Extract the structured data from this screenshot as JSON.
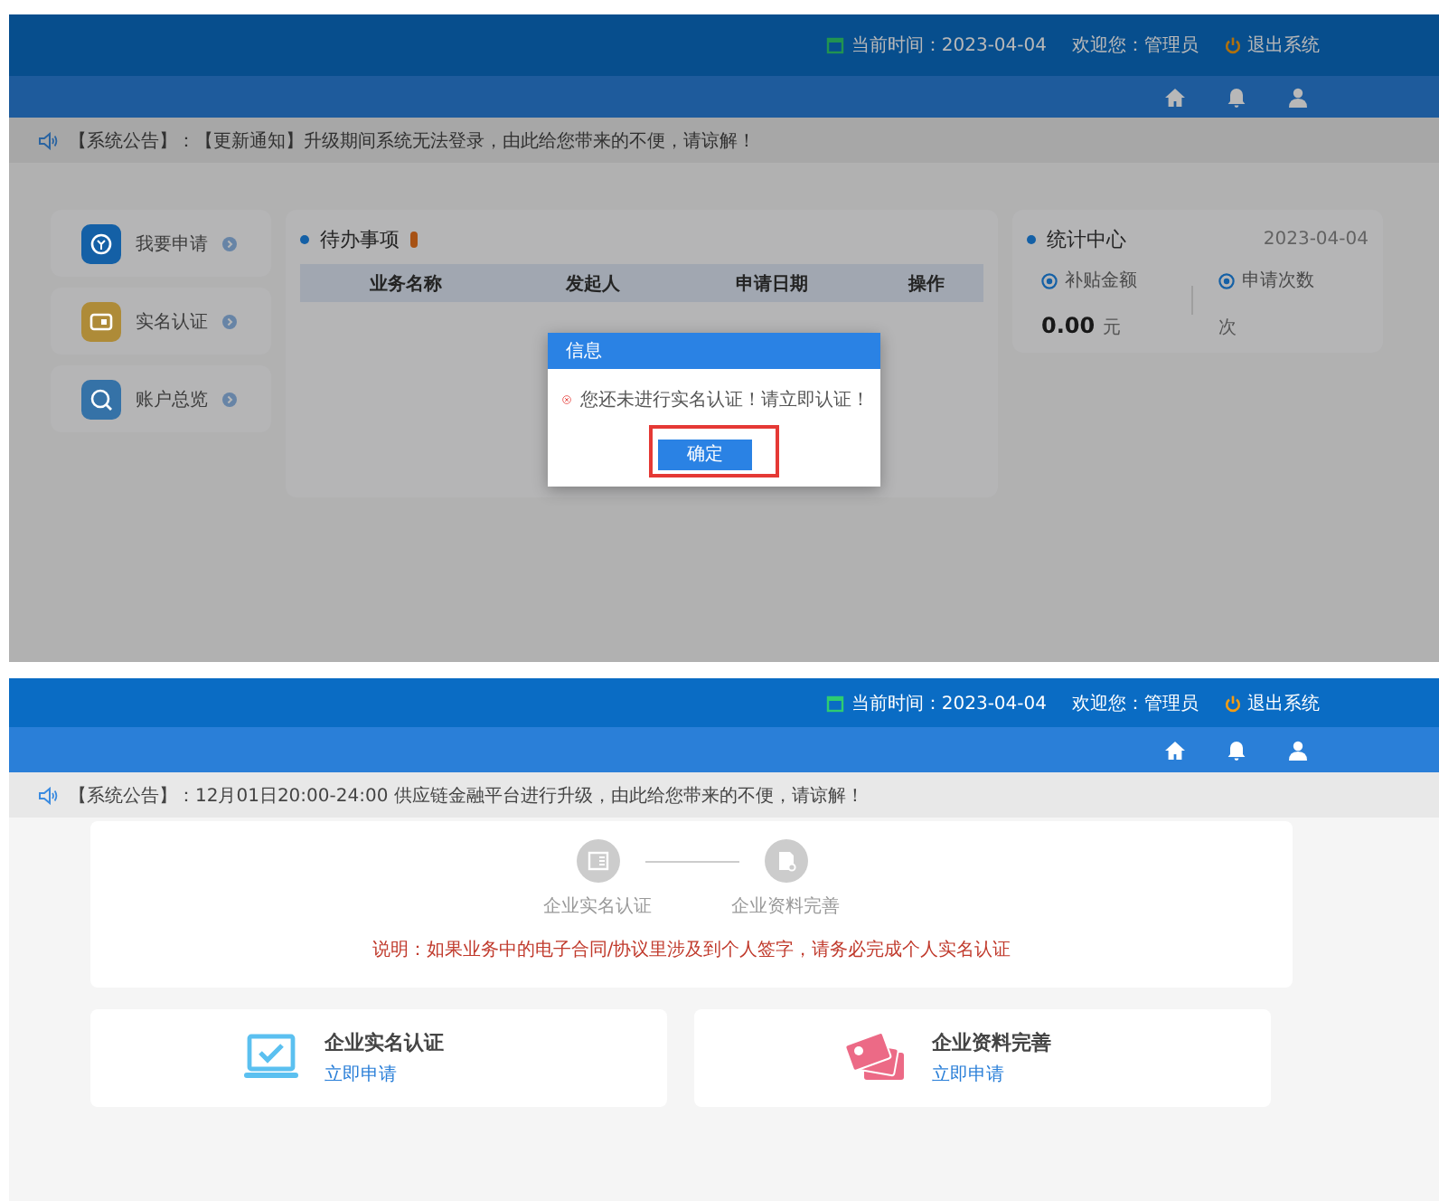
{
  "dashboard": {
    "header": {
      "time": "当前时间：2023-04-04",
      "welcome": "欢迎您：管理员",
      "logout": "退出系统"
    },
    "notice": "【系统公告】：【更新通知】升级期间系统无法登录，由此给您带来的不便，请谅解！",
    "side_menu": [
      {
        "kind": "apply",
        "label": "我要申请",
        "color": "#1460a6"
      },
      {
        "kind": "verify",
        "label": "实名认证",
        "color": "#ae8b38"
      },
      {
        "kind": "overview",
        "label": "账户总览",
        "color": "#3572a7"
      }
    ],
    "todo": {
      "title": "待办事项",
      "columns": [
        "业务名称",
        "发起人",
        "申请日期",
        "操作"
      ]
    },
    "stats": {
      "title": "统计中心",
      "date": "2023-04-04",
      "items": [
        {
          "label": "补贴金额",
          "value": "0.00",
          "unit": "元"
        },
        {
          "label": "申请次数",
          "unit": "次"
        }
      ]
    },
    "dialog": {
      "title": "信息",
      "message": "您还未进行实名认证！请立即认证！",
      "confirm": "确定",
      "highlighted": true
    }
  },
  "certification": {
    "header": {
      "time": "当前时间：2023-04-04",
      "welcome": "欢迎您：管理员",
      "logout": "退出系统"
    },
    "notice": "【系统公告】：12月01日20:00-24:00 供应链金融平台进行升级，由此给您带来的不便，请谅解！",
    "steps": [
      {
        "kind": "verify",
        "label": "企业实名认证"
      },
      {
        "kind": "profile",
        "label": "企业资料完善"
      }
    ],
    "note": "说明：如果业务中的电子合同/协议里涉及到个人签字，请务必完成个人实名认证",
    "cards": [
      {
        "kind": "verify",
        "title": "企业实名认证",
        "action": "立即申请"
      },
      {
        "kind": "profile",
        "title": "企业资料完善",
        "action": "立即申请"
      }
    ]
  }
}
